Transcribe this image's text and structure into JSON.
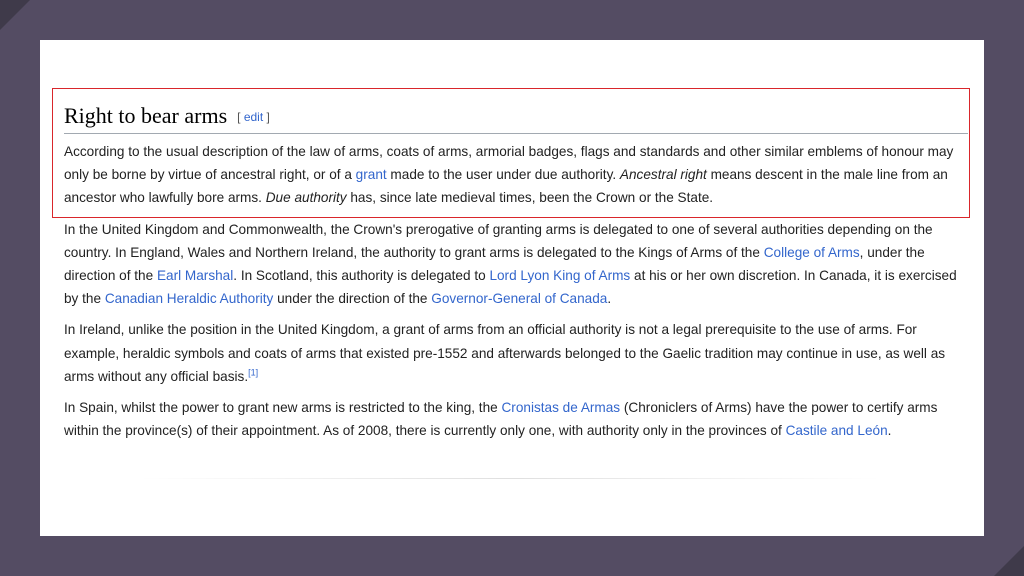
{
  "heading": {
    "title": "Right to bear arms",
    "edit_open": "[",
    "edit_label": "edit",
    "edit_close": "]"
  },
  "paragraphs": [
    {
      "t1": "According to the usual description of the law of arms, coats of arms, armorial badges, flags and standards and other similar emblems of honour may only be borne by virtue of ancestral right, or of a ",
      "l1": "grant",
      "t2": " made to the user under due authority. ",
      "i1": "Ancestral right",
      "t3": " means descent in the male line from an ancestor who lawfully bore arms. ",
      "i2": "Due authority",
      "t4": " has, since late medieval times, been the Crown or the State."
    },
    {
      "t1": "In the United Kingdom and Commonwealth, the Crown's prerogative of granting arms is delegated to one of several authorities depending on the country. In England, Wales and Northern Ireland, the authority to grant arms is delegated to the Kings of Arms of the ",
      "l1": "College of Arms",
      "t2": ", under the direction of the ",
      "l2": "Earl Marshal",
      "t3": ". In Scotland, this authority is delegated to ",
      "l3": "Lord Lyon King of Arms",
      "t4": " at his or her own discretion. In Canada, it is exercised by the ",
      "l4": "Canadian Heraldic Authority",
      "t5": " under the direction of the ",
      "l5": "Governor-General of Canada",
      "t6": "."
    },
    {
      "t1": "In Ireland, unlike the position in the United Kingdom, a grant of arms from an official authority is not a legal prerequisite to the use of arms. For example, heraldic symbols and coats of arms that existed pre-1552 and afterwards belonged to the Gaelic tradition may continue in use, as well as arms without any official basis.",
      "ref": "[1]"
    },
    {
      "t1": "In Spain, whilst the power to grant new arms is restricted to the king, the ",
      "l1": "Cronistas de Armas",
      "t2": " (Chroniclers of Arms) have the power to certify arms within the province(s) of their appointment. As of 2008, there is currently only one, with authority only in the provinces of ",
      "l2": "Castile and León",
      "t3": "."
    }
  ],
  "colors": {
    "link": "#3366cc",
    "highlight_border": "#d9262b",
    "background": "#544c63"
  }
}
